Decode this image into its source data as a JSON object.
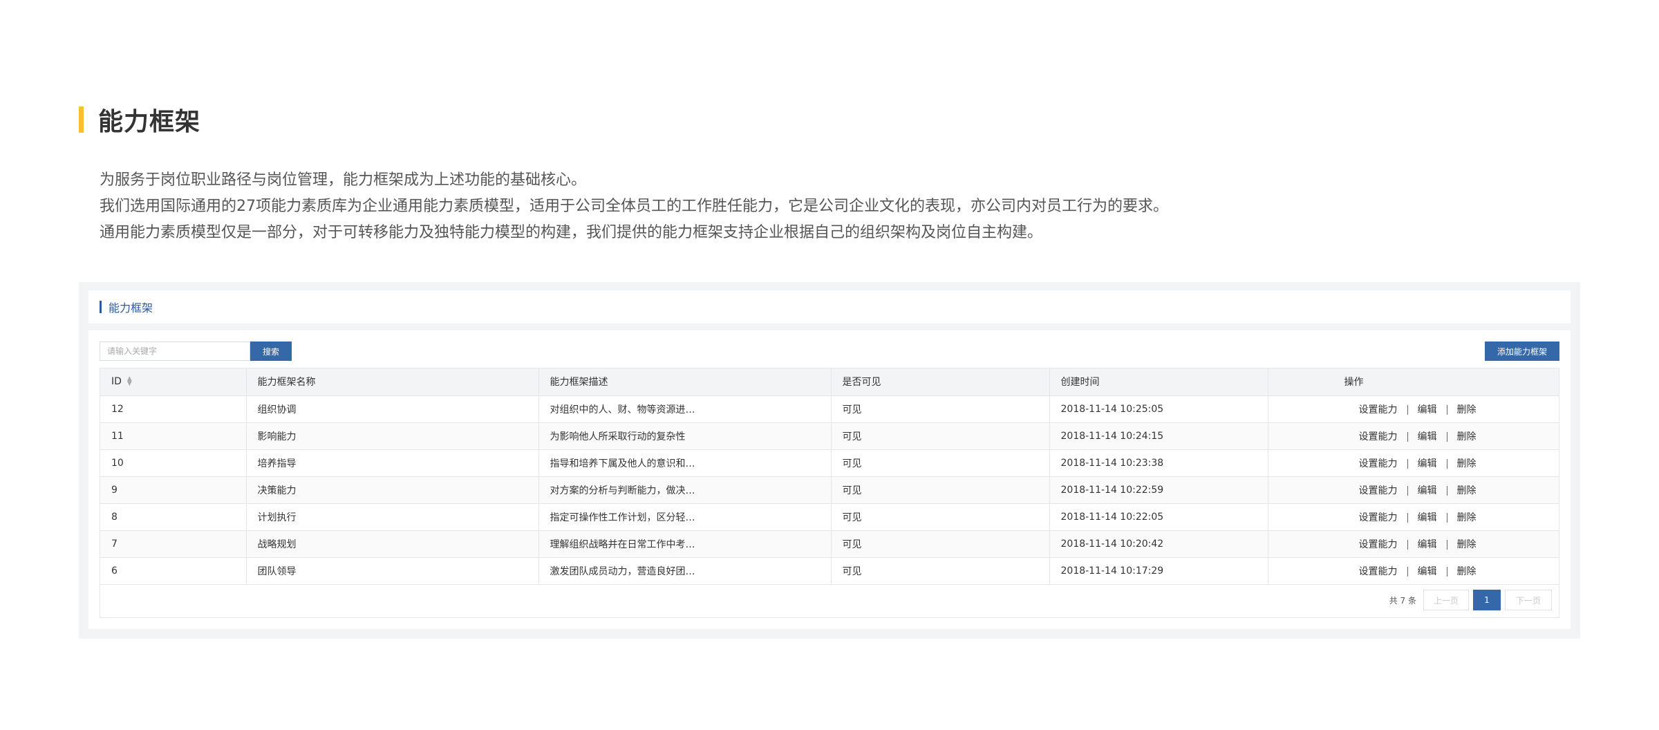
{
  "page": {
    "title": "能力框架",
    "intro": [
      "为服务于岗位职业路径与岗位管理，能力框架成为上述功能的基础核心。",
      "我们选用国际通用的27项能力素质库为企业通用能力素质模型，适用于公司全体员工的工作胜任能力，它是公司企业文化的表现，亦公司内对员工行为的要求。",
      "通用能力素质模型仅是一部分，对于可转移能力及独特能力模型的构建，我们提供的能力框架支持企业根据自己的组织架构及岗位自主构建。"
    ]
  },
  "panel": {
    "section_label": "能力框架",
    "search": {
      "placeholder": "请输入关键字",
      "button": "搜索"
    },
    "add_button": "添加能力框架",
    "columns": [
      "ID",
      "能力框架名称",
      "能力框架描述",
      "是否可见",
      "创建时间",
      "操作"
    ],
    "rows": [
      {
        "id": "12",
        "name": "组织协调",
        "desc": "对组织中的人、财、物等资源进…",
        "visible": "可见",
        "created": "2018-11-14 10:25:05"
      },
      {
        "id": "11",
        "name": "影响能力",
        "desc": "为影响他人所采取行动的复杂性",
        "visible": "可见",
        "created": "2018-11-14 10:24:15"
      },
      {
        "id": "10",
        "name": "培养指导",
        "desc": "指导和培养下属及他人的意识和…",
        "visible": "可见",
        "created": "2018-11-14 10:23:38"
      },
      {
        "id": "9",
        "name": "决策能力",
        "desc": "对方案的分析与判断能力，做决…",
        "visible": "可见",
        "created": "2018-11-14 10:22:59"
      },
      {
        "id": "8",
        "name": "计划执行",
        "desc": "指定可操作性工作计划，区分轻…",
        "visible": "可见",
        "created": "2018-11-14 10:22:05"
      },
      {
        "id": "7",
        "name": "战略规划",
        "desc": "理解组织战略并在日常工作中考…",
        "visible": "可见",
        "created": "2018-11-14 10:20:42"
      },
      {
        "id": "6",
        "name": "团队领导",
        "desc": "激发团队成员动力，营造良好团…",
        "visible": "可见",
        "created": "2018-11-14 10:17:29"
      }
    ],
    "row_actions": [
      "设置能力",
      "编辑",
      "删除"
    ],
    "pagination": {
      "total": "共 7 条",
      "prev": "上一页",
      "current": "1",
      "next": "下一页"
    }
  },
  "colors": {
    "accent_yellow": "#f5c22d",
    "primary_blue": "#3568a8",
    "section_blue": "#2d5a9c"
  },
  "icons": {
    "sort": "sort-icon"
  }
}
